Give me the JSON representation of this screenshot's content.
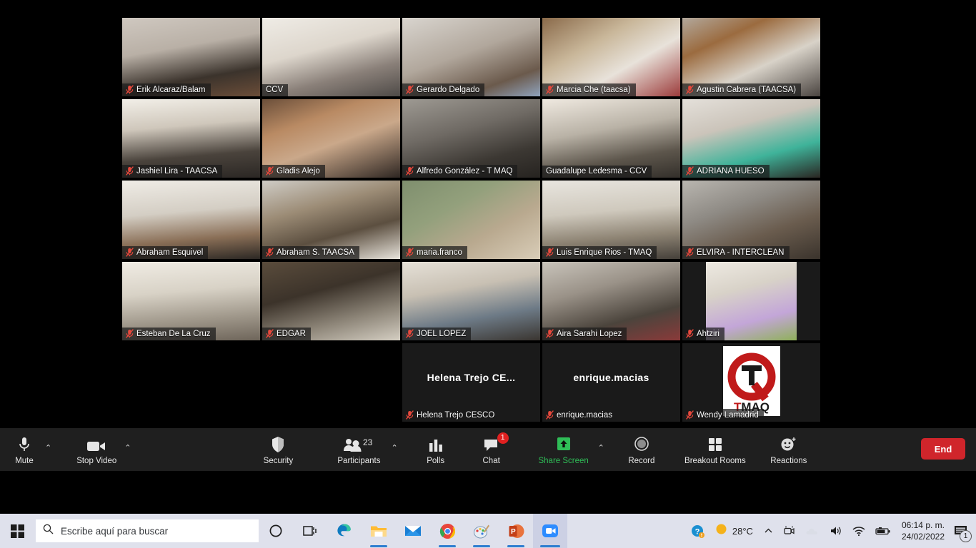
{
  "app": {
    "name": "Zoom Meeting"
  },
  "gallery": {
    "rows": [
      [
        {
          "name": "Erik Alcaraz/Balam",
          "muted": true,
          "active": false,
          "type": "video",
          "bg": "linear-gradient(170deg,#cfc8c0 0%,#b9b0a6 38%,#3b332c 72%,#6b4d38 100%)"
        },
        {
          "name": "CCV",
          "muted": false,
          "active": true,
          "type": "video",
          "bg": "linear-gradient(165deg,#efece6 0%,#ddd6cc 40%,#8a8079 70%,#4e4a47 100%)"
        },
        {
          "name": "Gerardo Delgado",
          "muted": true,
          "active": false,
          "type": "video",
          "bg": "linear-gradient(160deg,#d9d5cf 0%,#b1a79c 45%,#6b5a4c 78%,#8fa3bd 100%)"
        },
        {
          "name": "Marcia Che (taacsa)",
          "muted": true,
          "active": false,
          "type": "video",
          "bg": "linear-gradient(150deg,#8a6a4a 0%,#c9b79a 35%,#e8e2da 62%,#9c3b3b 100%)"
        },
        {
          "name": "Agustin Cabrera (TAACSA)",
          "muted": true,
          "active": false,
          "type": "video",
          "bg": "linear-gradient(155deg,#b2a89c 0%,#9b6b3f 28%,#d8d2c8 60%,#4a4440 100%)"
        }
      ],
      [
        {
          "name": "Jashiel Lira - TAACSA",
          "muted": true,
          "active": false,
          "type": "video",
          "bg": "linear-gradient(175deg,#f2efe8 0%,#cfc7bb 35%,#4a433c 70%,#2b2724 100%)"
        },
        {
          "name": "Gladis Alejo",
          "muted": true,
          "active": false,
          "type": "video",
          "bg": "linear-gradient(160deg,#6b4f3a 0%,#b98a63 30%,#caa88a 55%,#2e2622 100%)"
        },
        {
          "name": "Alfredo González - T MAQ",
          "muted": true,
          "active": false,
          "type": "video",
          "bg": "linear-gradient(165deg,#9e9a93 0%,#6f6a64 40%,#3c3833 72%,#262320 100%)"
        },
        {
          "name": "Guadalupe Ledesma - CCV",
          "muted": false,
          "active": false,
          "type": "video",
          "bg": "linear-gradient(170deg,#efe9e0 0%,#b9b2a6 40%,#5d564c 72%,#332f2a 100%)"
        },
        {
          "name": "ADRIANA HUESO",
          "muted": true,
          "active": false,
          "type": "video",
          "bg": "linear-gradient(165deg,#e4e0da 0%,#cbc4ba 35%,#3fb39a 68%,#2a2622 100%)"
        }
      ],
      [
        {
          "name": "Abraham Esquivel",
          "muted": true,
          "active": false,
          "type": "video",
          "bg": "linear-gradient(175deg,#efece6 0%,#d4cec4 40%,#8a6f57 72%,#2c2824 100%)"
        },
        {
          "name": "Abraham S. TAACSA",
          "muted": true,
          "active": false,
          "type": "video",
          "bg": "linear-gradient(165deg,#cfccc6 0%,#9c8c76 35%,#5c4f40 65%,#e8e4dc 100%)"
        },
        {
          "name": "maria.franco",
          "muted": true,
          "active": false,
          "type": "video",
          "bg": "linear-gradient(150deg,#7f8f6e 0%,#93a07c 35%,#b9a98f 65%,#d9cdb8 100%)"
        },
        {
          "name": "Luis Enrique Rios - TMAQ",
          "muted": true,
          "active": false,
          "type": "video",
          "bg": "linear-gradient(175deg,#e8e5df 0%,#cfc9bd 40%,#8f8575 70%,#45403a 100%)"
        },
        {
          "name": "ELVIRA - INTERCLEAN",
          "muted": true,
          "active": false,
          "type": "video",
          "bg": "linear-gradient(160deg,#b9b6b0 0%,#8e8a84 35%,#6a5c4e 65%,#3a332c 100%)"
        }
      ],
      [
        {
          "name": "Esteban De La Cruz",
          "muted": true,
          "active": false,
          "type": "video",
          "bg": "linear-gradient(175deg,#f0ece4 0%,#d8d2c6 38%,#a1998c 70%,#6e655a 100%)"
        },
        {
          "name": "EDGAR",
          "muted": true,
          "active": false,
          "type": "video",
          "bg": "linear-gradient(165deg,#5a4c3c 0%,#3c332a 38%,#8d8578 70%,#d4cec2 100%)"
        },
        {
          "name": "JOEL LOPEZ",
          "muted": true,
          "active": false,
          "type": "video",
          "bg": "linear-gradient(170deg,#e6e1d8 0%,#c8c0b3 35%,#6d7a86 68%,#3a3530 100%)"
        },
        {
          "name": "Aira Sarahi Lopez",
          "muted": true,
          "active": false,
          "type": "video",
          "bg": "linear-gradient(165deg,#c9c4bb 0%,#9a9288 35%,#4b443c 70%,#8a3a3a 100%)"
        },
        {
          "name": "Ahtziri",
          "muted": true,
          "active": false,
          "type": "video-pillar",
          "bg": "linear-gradient(165deg,#eeeae2 0%,#d8d2c8 35%,#c3a6d8 70%,#8fb05a 100%)"
        }
      ],
      [
        {
          "name": "Helena Trejo CESCO",
          "display_name": "Helena Trejo CE...",
          "muted": true,
          "active": false,
          "type": "name"
        },
        {
          "name": "enrique.macias",
          "display_name": "enrique.macias",
          "muted": true,
          "active": false,
          "type": "name"
        },
        {
          "name": "Wendy Lamadrid",
          "muted": true,
          "active": false,
          "type": "logo",
          "logo_text_main": "Q",
          "logo_text_inner": "T",
          "logo_text_bottom": "TMAQ"
        }
      ]
    ]
  },
  "toolbar": {
    "mute_label": "Mute",
    "video_label": "Stop Video",
    "security_label": "Security",
    "participants_label": "Participants",
    "participants_count": "23",
    "polls_label": "Polls",
    "chat_label": "Chat",
    "chat_badge": "1",
    "share_label": "Share Screen",
    "record_label": "Record",
    "breakout_label": "Breakout Rooms",
    "reactions_label": "Reactions",
    "end_label": "End",
    "accent_green": "#2fbd57",
    "end_color": "#d0252b",
    "active_speaker_border": "#e8f53c"
  },
  "taskbar": {
    "search_placeholder": "Escribe aquí para buscar",
    "weather_temp": "28°C",
    "clock_time": "06:14 p. m.",
    "clock_date": "24/02/2022",
    "notification_count": "1",
    "apps": [
      {
        "name": "cortana"
      },
      {
        "name": "task-view"
      },
      {
        "name": "edge"
      },
      {
        "name": "file-explorer"
      },
      {
        "name": "mail"
      },
      {
        "name": "chrome"
      },
      {
        "name": "paint"
      },
      {
        "name": "powerpoint"
      },
      {
        "name": "zoom"
      }
    ]
  }
}
